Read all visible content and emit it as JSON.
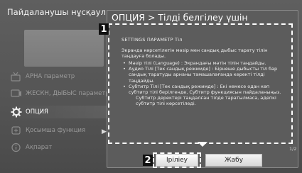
{
  "menu": {
    "title": "Пайдаланушы нұсқаулығы",
    "items": [
      {
        "label": "АРНА параметр",
        "icon": "antenna-icon"
      },
      {
        "label": "ЖЕСКН, ДЫБЫС параметр",
        "icon": "picture-sound-icon"
      },
      {
        "label": "ОПЦИЯ",
        "icon": "gear-icon"
      },
      {
        "label": "Қосымша функция",
        "icon": "extra-function-icon"
      },
      {
        "label": "Ақпарат",
        "icon": "info-icon"
      }
    ],
    "active_index": 2
  },
  "dialog": {
    "title": "ОПЦИЯ > Тілді белгілеу үшін",
    "callout_1": "1",
    "callout_2": "2",
    "breadcrumb": "SETTINGS  ПАРАМЕТР  Тіл",
    "intro": "Экранда көрсетілетін мәзір мен сандық дыбыс тарату тілін таңдауға болады.",
    "bullets": [
      "Мәзір тілі (Language) : Экрандағы мәтін тілін таңдайды.",
      "Аудио Тілі [Тек сандық режимде] : Бірнеше дыбысты тіл бар сандық таратуды арнаны тамашалағанда керекті тілді таңдайды.",
      "Субтитр Тілі [Тек сандық режимде] : Екі немесе одан көп субтитр тілі берілгенде, Субтитр функциясын пайдаланыңыз."
    ],
    "sub_note": "Субтитр деректері таңдалған тілде таратылмаса, әдепкі субтитр тілі көрсетіледі.",
    "page_indicator": "1/2",
    "buttons": {
      "apply": "Іріліеу",
      "close": "Жабу"
    }
  },
  "colors": {
    "background": "#555555",
    "dialog": "#5c5c5c",
    "highlight": "#ffffff"
  }
}
